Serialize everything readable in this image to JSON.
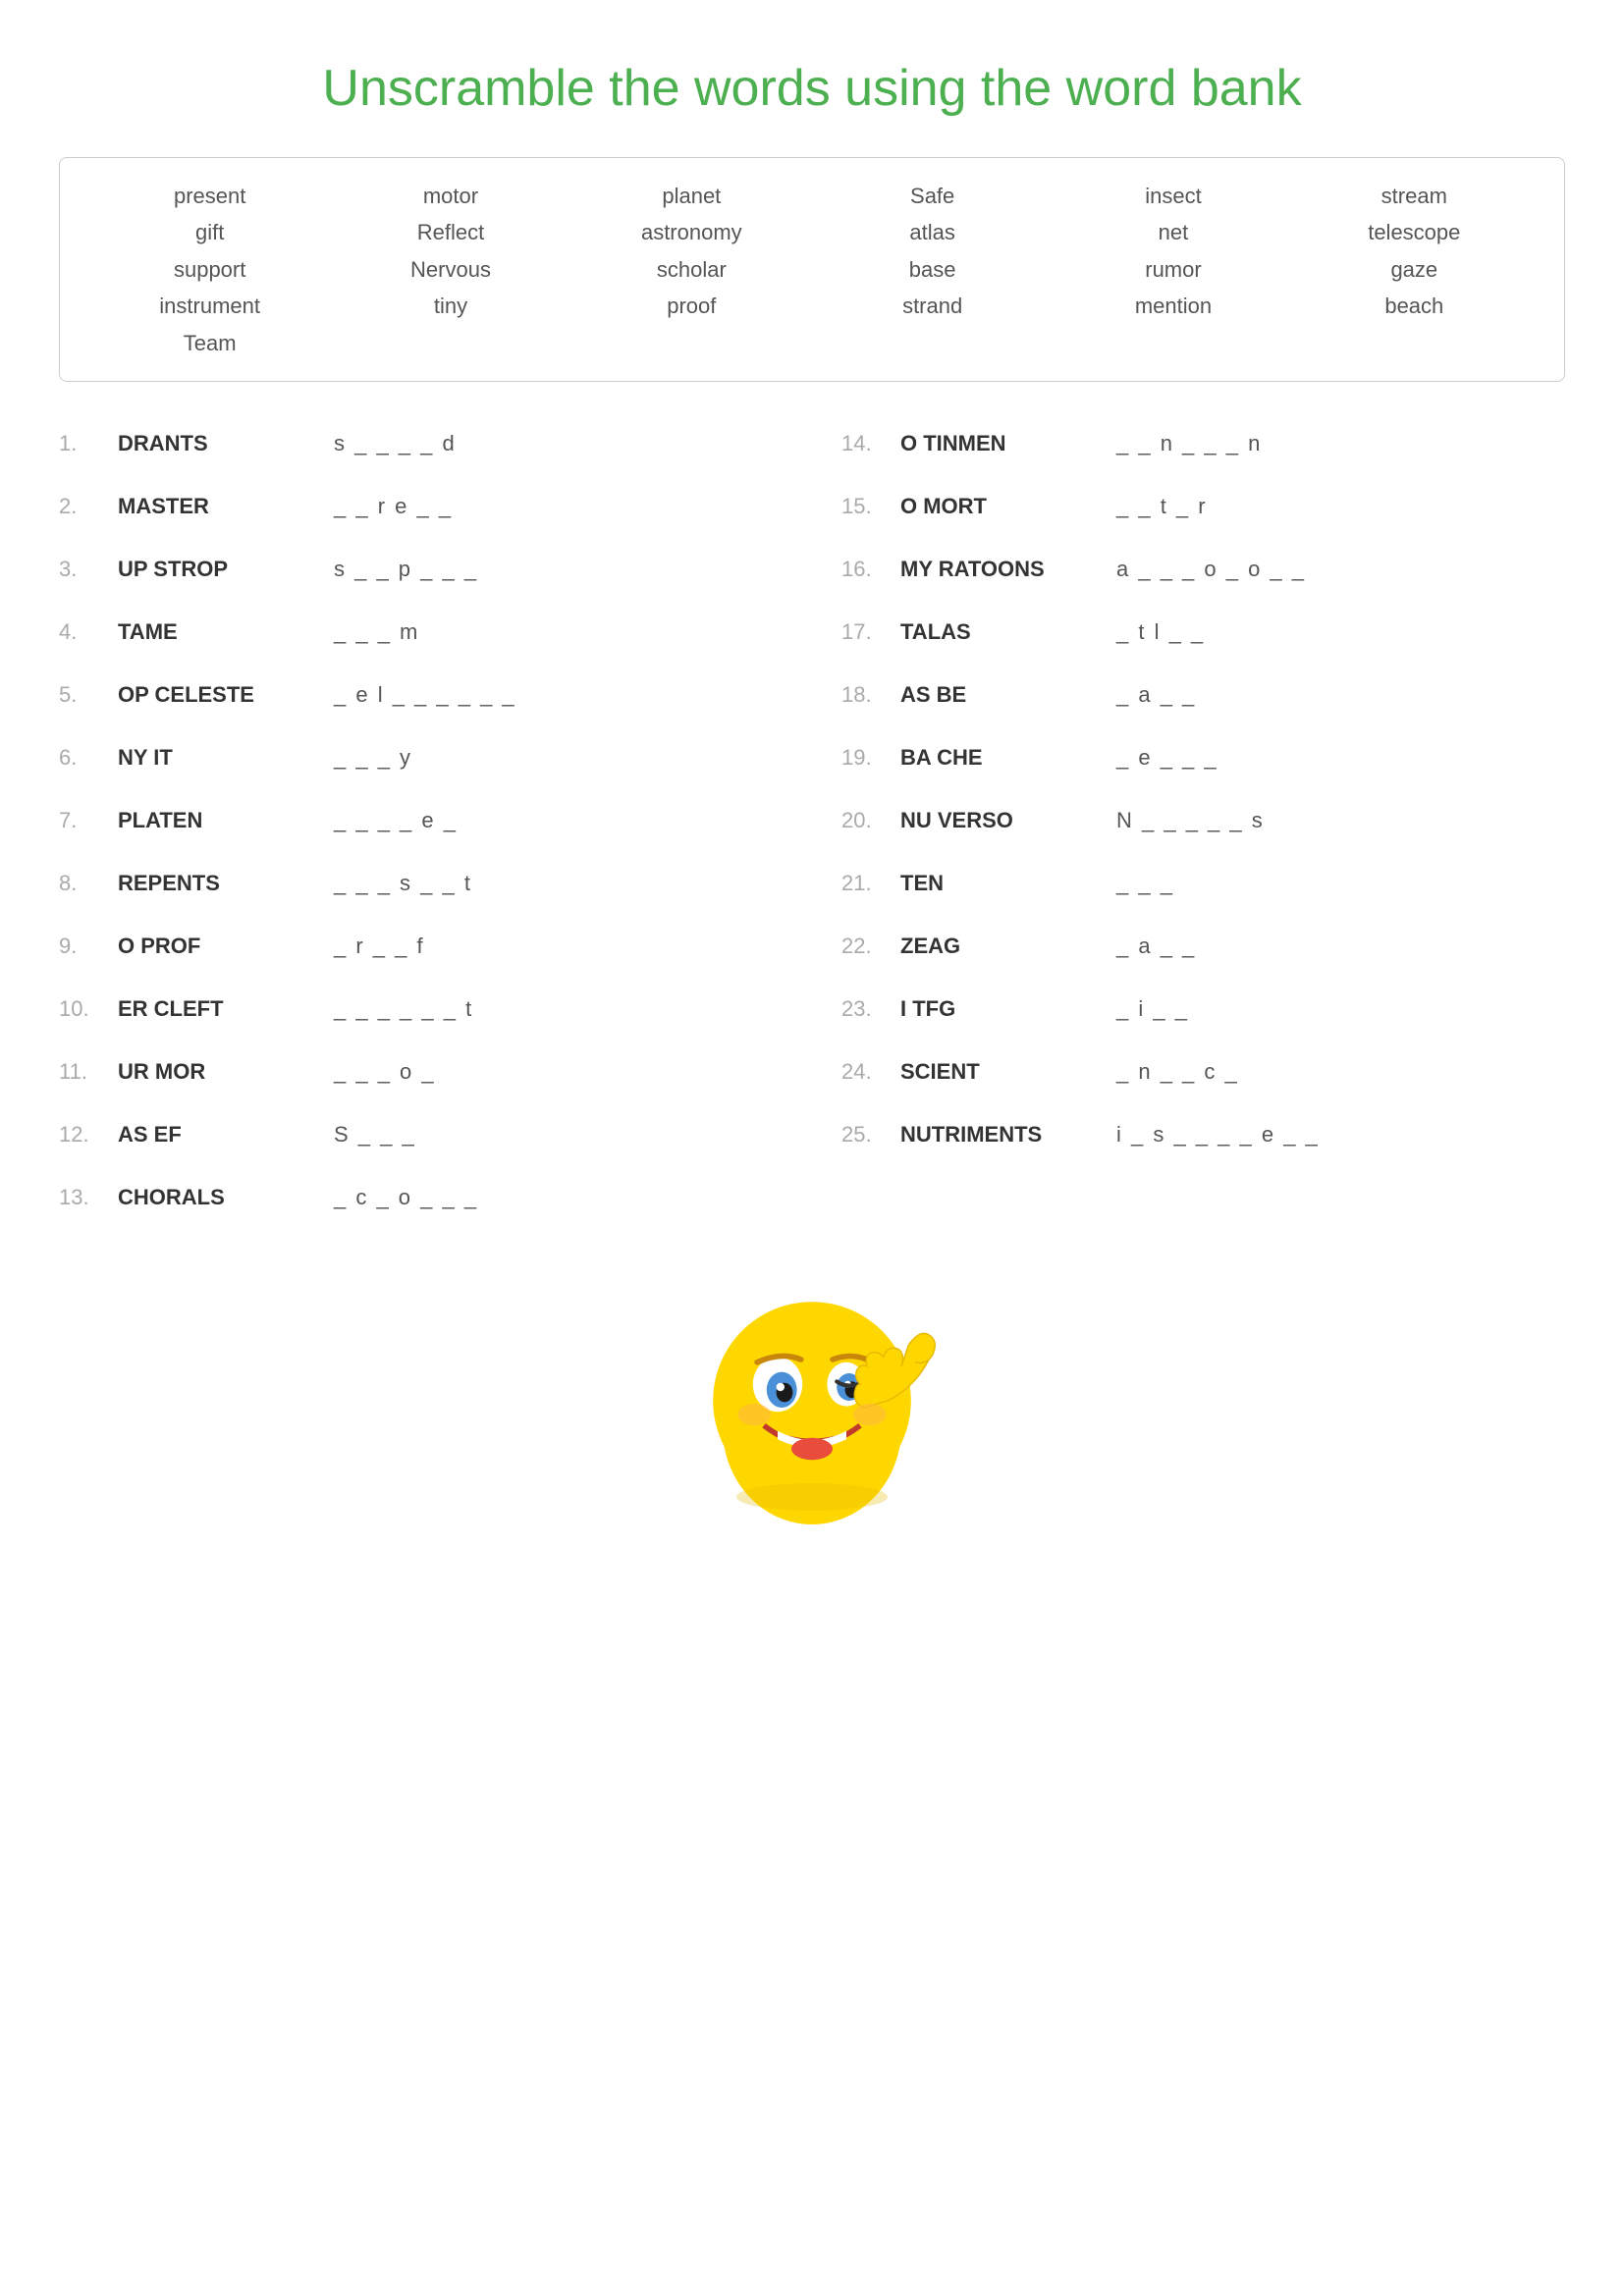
{
  "title": "Unscramble the words using  the word bank",
  "wordBank": {
    "columns": [
      [
        "present",
        "gift",
        "support",
        "instrument",
        "Team"
      ],
      [
        "motor",
        "Reflect",
        "Nervous",
        "tiny"
      ],
      [
        "planet",
        "astronomy",
        "scholar",
        "proof"
      ],
      [
        "Safe",
        "atlas",
        "base",
        "strand"
      ],
      [
        "insect",
        "net",
        "rumor",
        "mention"
      ],
      [
        "stream",
        "telescope",
        "gaze",
        "beach"
      ]
    ]
  },
  "questions": [
    {
      "number": "1.",
      "scrambled": "DRANTS",
      "hint": "s _ _ _ _ d"
    },
    {
      "number": "2.",
      "scrambled": "MASTER",
      "hint": "_ _ r e _ _"
    },
    {
      "number": "3.",
      "scrambled": "UP STROP",
      "hint": "s _ _ p _ _ _"
    },
    {
      "number": "4.",
      "scrambled": "TAME",
      "hint": "_ _ _ m"
    },
    {
      "number": "5.",
      "scrambled": "OP CELESTE",
      "hint": "_ e l _ _ _ _ _ _"
    },
    {
      "number": "6.",
      "scrambled": "NY IT",
      "hint": "_ _ _ y"
    },
    {
      "number": "7.",
      "scrambled": "PLATEN",
      "hint": "_ _ _ _ e _"
    },
    {
      "number": "8.",
      "scrambled": "REPENTS",
      "hint": "_ _ _ s _ _ t"
    },
    {
      "number": "9.",
      "scrambled": "O PROF",
      "hint": "_ r _ _ f"
    },
    {
      "number": "10.",
      "scrambled": "ER CLEFT",
      "hint": "_ _ _ _ _ _ t"
    },
    {
      "number": "11.",
      "scrambled": "UR MOR",
      "hint": "_ _ _ o _"
    },
    {
      "number": "12.",
      "scrambled": "AS EF",
      "hint": "S _ _ _"
    },
    {
      "number": "13.",
      "scrambled": "CHORALS",
      "hint": "_ c _ o _ _ _"
    },
    {
      "number": "14.",
      "scrambled": "O TINMEN",
      "hint": "_ _ n _ _ _ n"
    },
    {
      "number": "15.",
      "scrambled": "O MORT",
      "hint": "_ _ t _ r"
    },
    {
      "number": "16.",
      "scrambled": "MY RATOONS",
      "hint": "a _ _ _ o _ o _ _"
    },
    {
      "number": "17.",
      "scrambled": "TALAS",
      "hint": "_ t l _ _"
    },
    {
      "number": "18.",
      "scrambled": "AS BE",
      "hint": "_ a _ _"
    },
    {
      "number": "19.",
      "scrambled": "BA CHE",
      "hint": "_ e _ _ _"
    },
    {
      "number": "20.",
      "scrambled": "NU VERSO",
      "hint": "N _ _ _ _ _ s"
    },
    {
      "number": "21.",
      "scrambled": "TEN",
      "hint": "_ _ _"
    },
    {
      "number": "22.",
      "scrambled": "ZEAG",
      "hint": "_ a _ _"
    },
    {
      "number": "23.",
      "scrambled": "I TFG",
      "hint": "_ i _ _"
    },
    {
      "number": "24.",
      "scrambled": "SCIENT",
      "hint": "_ n _ _ c _"
    },
    {
      "number": "25.",
      "scrambled": "NUTRIMENTS",
      "hint": "i _ s _ _ _ _ e _ _"
    }
  ]
}
